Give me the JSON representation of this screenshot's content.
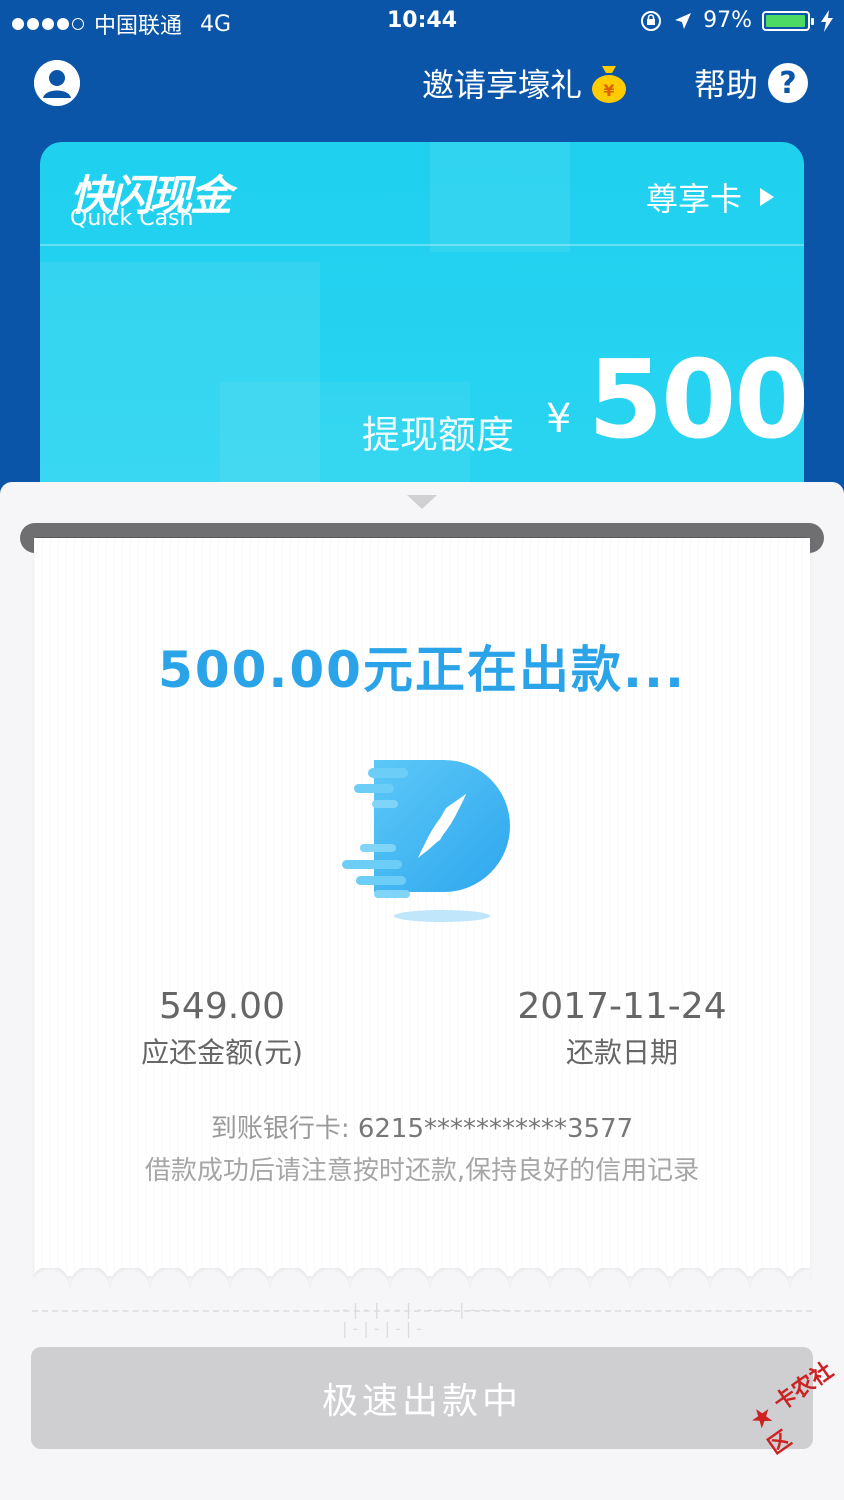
{
  "status_bar": {
    "carrier": "中国联通",
    "network": "4G",
    "time": "10:44",
    "battery": "97%",
    "battery_level": 0.97
  },
  "header": {
    "invite_label": "邀请享壕礼",
    "help_label": "帮助"
  },
  "card": {
    "brand_cn": "快闪现金",
    "brand_en": "Quick Cash",
    "tier_label": "尊享卡",
    "limit_label": "提现额度",
    "currency": "¥",
    "limit_amount": "500"
  },
  "receipt": {
    "status_title": "500.00元正在出款...",
    "repay_amount_value": "549.00",
    "repay_amount_label": "应还金额(元)",
    "repay_date_value": "2017-11-24",
    "repay_date_label": "还款日期",
    "bank_card_label": "到账银行卡: ",
    "bank_card_number": "6215***********3577",
    "notice": "借款成功后请注意按时还款,保持良好的信用记录"
  },
  "action": {
    "button_label": "极速出款中"
  },
  "watermark": "卡农社区",
  "colors": {
    "header_bg": "#0a55a8",
    "card_bg": "#1fd0ef",
    "accent": "#2aa3e8",
    "button_disabled": "#cfcfd2"
  }
}
